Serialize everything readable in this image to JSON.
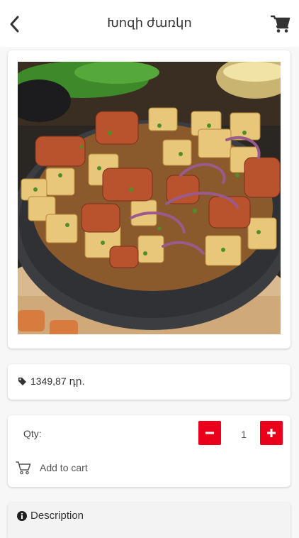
{
  "header": {
    "title": "Խոզի ժառկո"
  },
  "product": {
    "price": "1349,87 դր."
  },
  "quantity": {
    "label": "Qty:",
    "value": "1"
  },
  "actions": {
    "add_to_cart": "Add to cart"
  },
  "description": {
    "title": "Description"
  },
  "colors": {
    "accent": "#e9001a"
  }
}
